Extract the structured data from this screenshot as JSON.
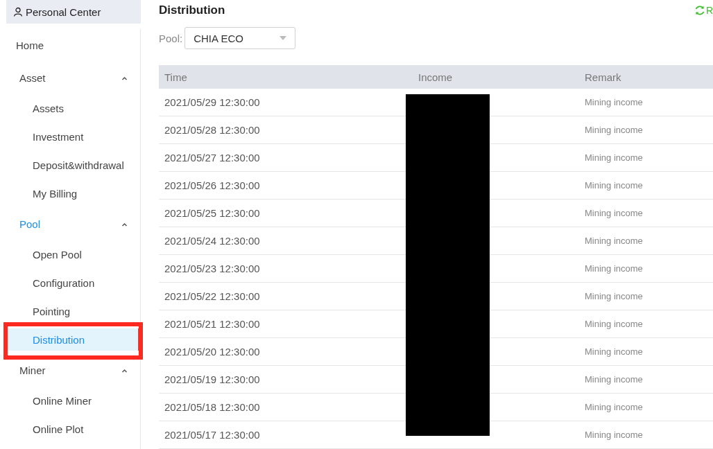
{
  "sidebar": {
    "header": "Personal Center",
    "items": [
      {
        "label": "Home",
        "kind": "link",
        "selected": false,
        "highlighted": false
      },
      {
        "label": "Asset",
        "kind": "group",
        "selected": false,
        "expanded": true,
        "children": [
          {
            "label": "Assets",
            "selected": false,
            "highlighted": false
          },
          {
            "label": "Investment",
            "selected": false,
            "highlighted": false
          },
          {
            "label": "Deposit&withdrawal",
            "selected": false,
            "highlighted": false
          },
          {
            "label": "My Billing",
            "selected": false,
            "highlighted": false
          }
        ]
      },
      {
        "label": "Pool",
        "kind": "group",
        "selected": true,
        "expanded": true,
        "children": [
          {
            "label": "Open Pool",
            "selected": false,
            "highlighted": false
          },
          {
            "label": "Configuration",
            "selected": false,
            "highlighted": false
          },
          {
            "label": "Pointing",
            "selected": false,
            "highlighted": false
          },
          {
            "label": "Distribution",
            "selected": true,
            "highlighted": true
          }
        ]
      },
      {
        "label": "Miner",
        "kind": "group",
        "selected": false,
        "expanded": true,
        "children": [
          {
            "label": "Online Miner",
            "selected": false,
            "highlighted": false
          },
          {
            "label": "Online Plot",
            "selected": false,
            "highlighted": false
          }
        ]
      }
    ]
  },
  "main": {
    "title": "Distribution",
    "refresh_label": "R",
    "filter": {
      "label": "Pool:",
      "value": "CHIA ECO"
    },
    "table": {
      "columns": [
        "Time",
        "Income",
        "Remark"
      ],
      "income_redacted": true,
      "rows": [
        {
          "time": "2021/05/29 12:30:00",
          "remark": "Mining income"
        },
        {
          "time": "2021/05/28 12:30:00",
          "remark": "Mining income"
        },
        {
          "time": "2021/05/27 12:30:00",
          "remark": "Mining income"
        },
        {
          "time": "2021/05/26 12:30:00",
          "remark": "Mining income"
        },
        {
          "time": "2021/05/25 12:30:00",
          "remark": "Mining income"
        },
        {
          "time": "2021/05/24 12:30:00",
          "remark": "Mining income"
        },
        {
          "time": "2021/05/23 12:30:00",
          "remark": "Mining income"
        },
        {
          "time": "2021/05/22 12:30:00",
          "remark": "Mining income"
        },
        {
          "time": "2021/05/21 12:30:00",
          "remark": "Mining income"
        },
        {
          "time": "2021/05/20 12:30:00",
          "remark": "Mining income"
        },
        {
          "time": "2021/05/19 12:30:00",
          "remark": "Mining income"
        },
        {
          "time": "2021/05/18 12:30:00",
          "remark": "Mining income"
        },
        {
          "time": "2021/05/17 12:30:00",
          "remark": "Mining income"
        }
      ]
    }
  }
}
